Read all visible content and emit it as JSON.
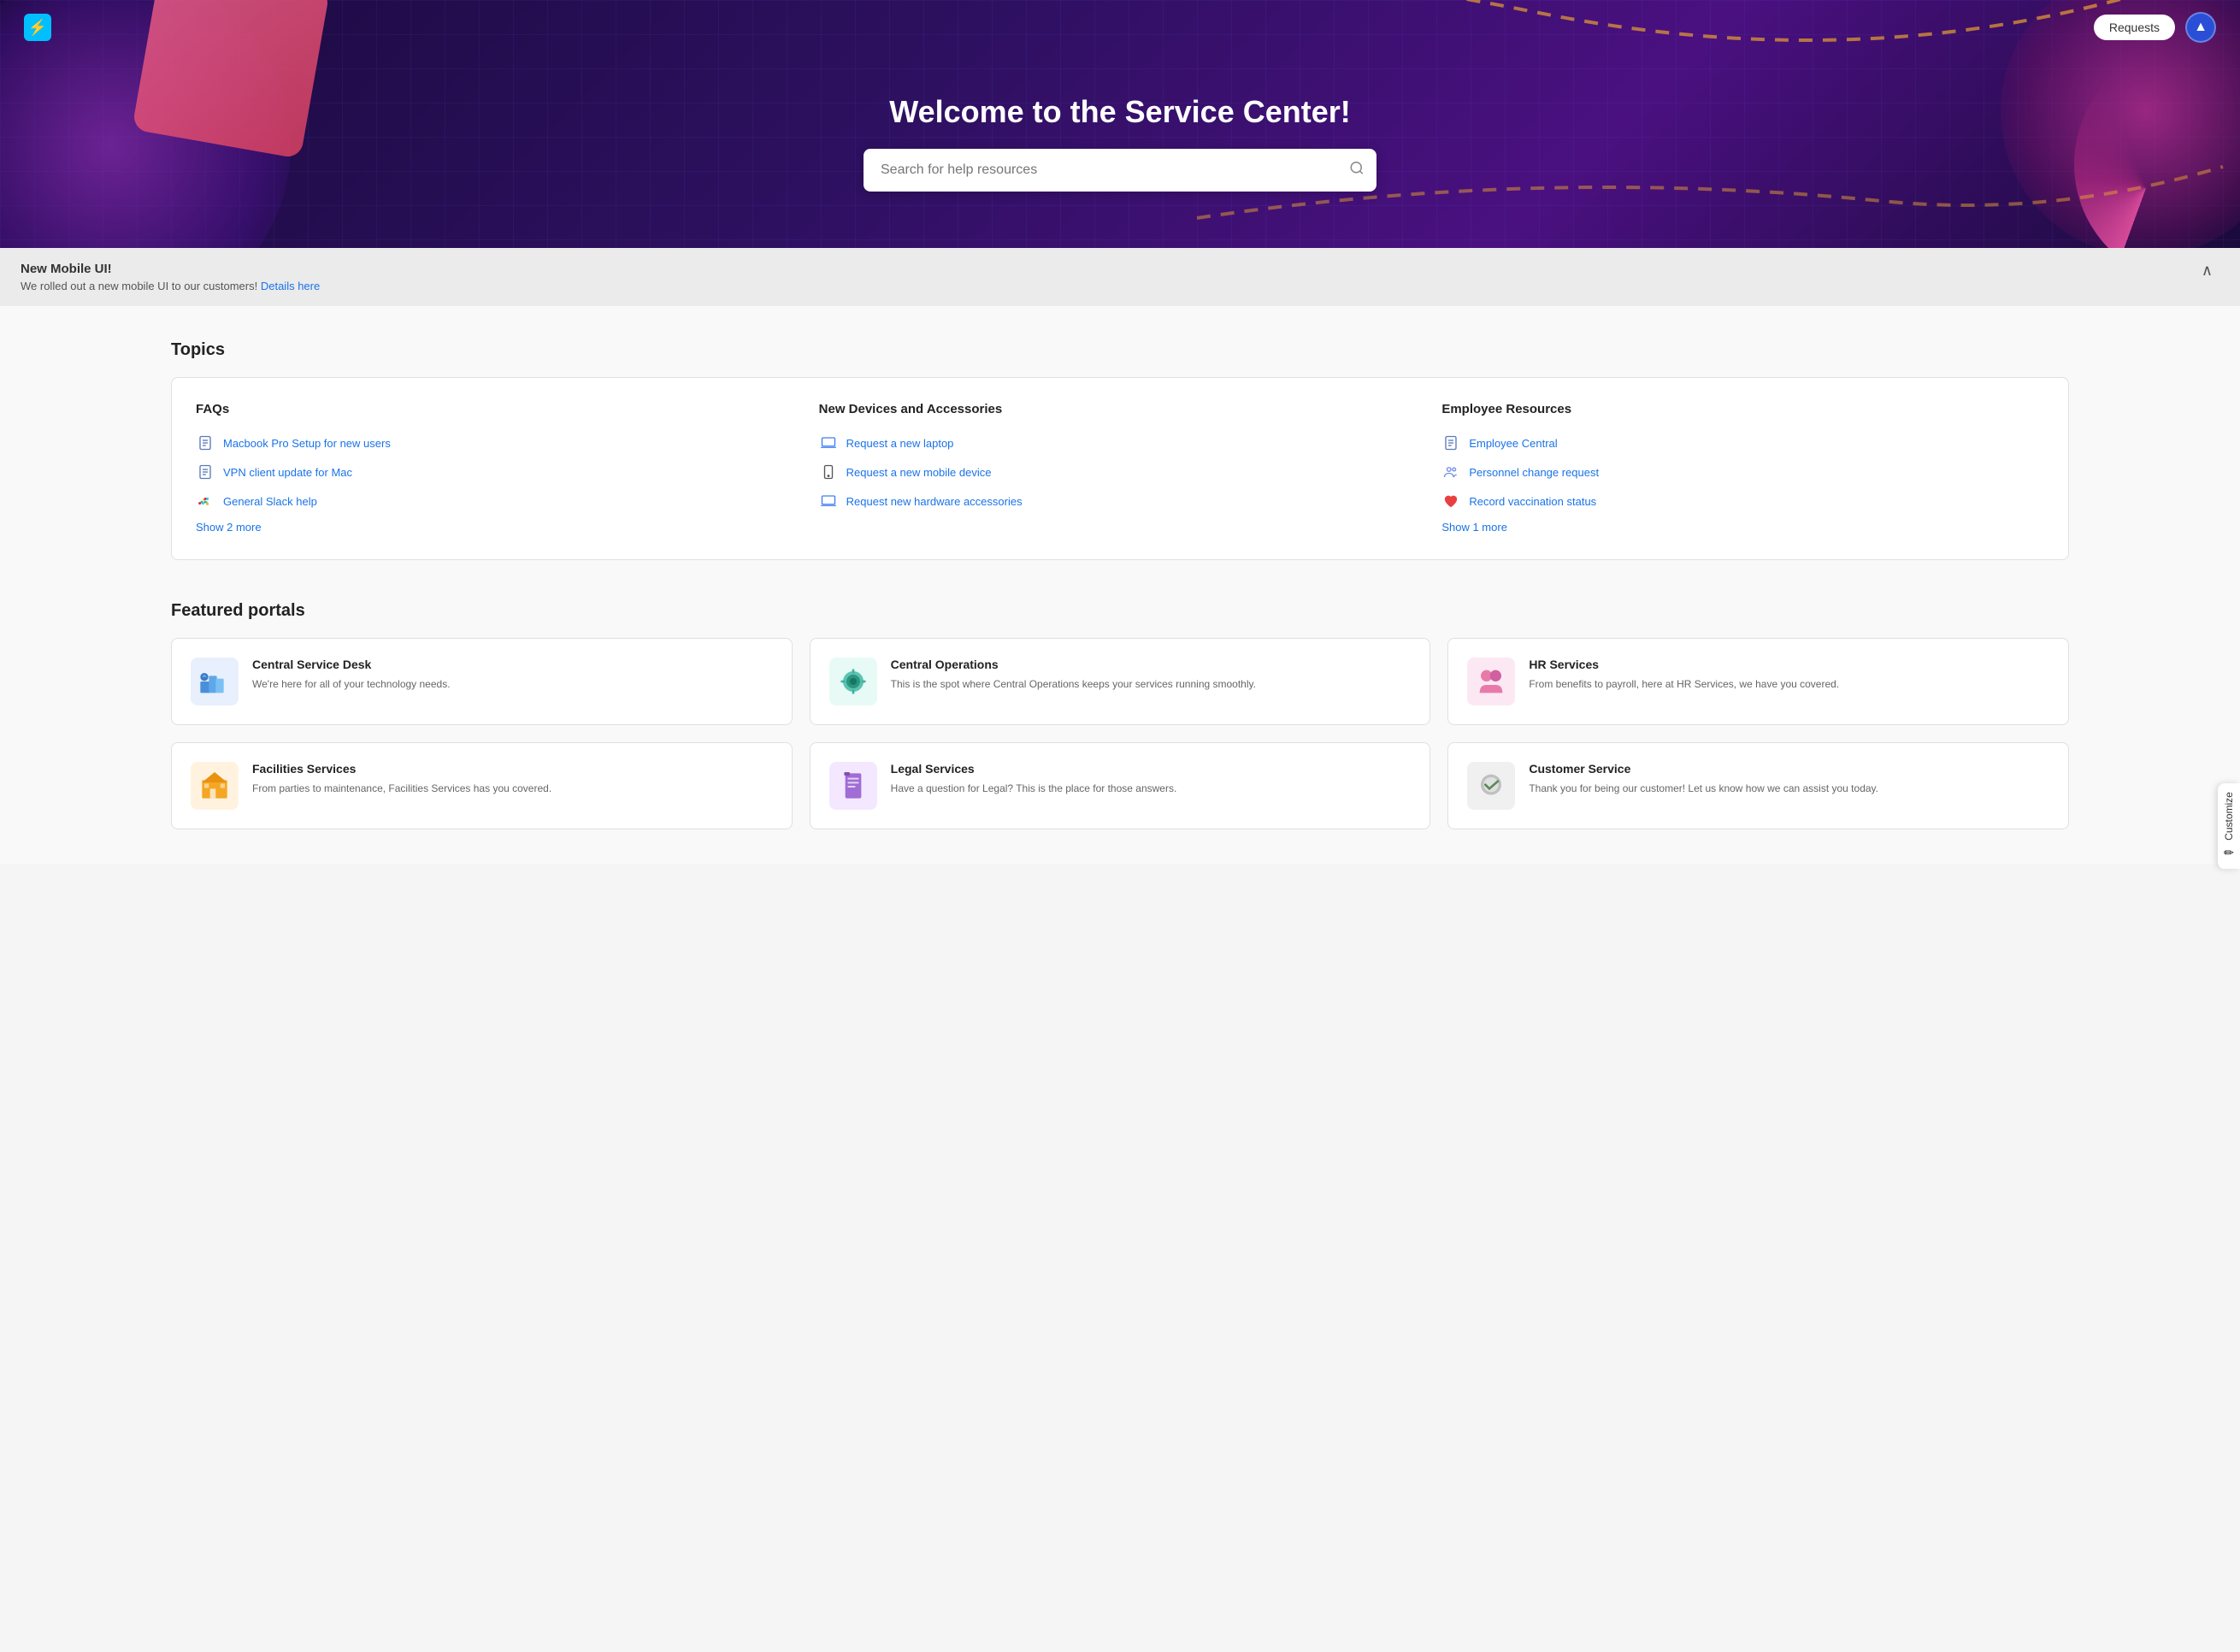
{
  "navbar": {
    "logo_icon": "⚡",
    "requests_label": "Requests",
    "avatar_icon": "▲"
  },
  "customize": {
    "label": "Customize",
    "icon": "✏"
  },
  "hero": {
    "title": "Welcome to the Service Center!",
    "search_placeholder": "Search for help resources"
  },
  "announcement": {
    "title": "New Mobile UI!",
    "body": "We rolled out a new mobile UI to our customers!",
    "link_text": "Details here",
    "toggle_icon": "^"
  },
  "topics": {
    "section_title": "Topics",
    "columns": [
      {
        "title": "FAQs",
        "items": [
          {
            "label": "Macbook Pro Setup for new users",
            "icon": "doc"
          },
          {
            "label": "VPN client update for Mac",
            "icon": "doc"
          },
          {
            "label": "General Slack help",
            "icon": "slack"
          }
        ],
        "show_more": "Show 2 more"
      },
      {
        "title": "New Devices and Accessories",
        "items": [
          {
            "label": "Request a new laptop",
            "icon": "laptop"
          },
          {
            "label": "Request a new mobile device",
            "icon": "mobile"
          },
          {
            "label": "Request new hardware accessories",
            "icon": "laptop"
          }
        ],
        "show_more": null
      },
      {
        "title": "Employee Resources",
        "items": [
          {
            "label": "Employee Central",
            "icon": "doc"
          },
          {
            "label": "Personnel change request",
            "icon": "people"
          },
          {
            "label": "Record vaccination status",
            "icon": "heart"
          }
        ],
        "show_more": "Show 1 more"
      }
    ]
  },
  "featured_portals": {
    "section_title": "Featured portals",
    "portals": [
      {
        "name": "Central Service Desk",
        "description": "We're here for all of your technology needs.",
        "icon_type": "blue",
        "icon_emoji": "🏗"
      },
      {
        "name": "Central Operations",
        "description": "This is the spot where Central Operations keeps your services running smoothly.",
        "icon_type": "teal",
        "icon_emoji": "⚙"
      },
      {
        "name": "HR Services",
        "description": "From benefits to payroll, here at HR Services, we have you covered.",
        "icon_type": "pink",
        "icon_emoji": "🤝"
      },
      {
        "name": "Facilities Services",
        "description": "From parties to maintenance, Facilities Services has you covered.",
        "icon_type": "orange",
        "icon_emoji": "🏢"
      },
      {
        "name": "Legal Services",
        "description": "Have a question for Legal? This is the place for those answers.",
        "icon_type": "purple",
        "icon_emoji": "📱"
      },
      {
        "name": "Customer Service",
        "description": "Thank you for being our customer! Let us know how we can assist you today.",
        "icon_type": "gray",
        "icon_emoji": "✅"
      }
    ]
  }
}
